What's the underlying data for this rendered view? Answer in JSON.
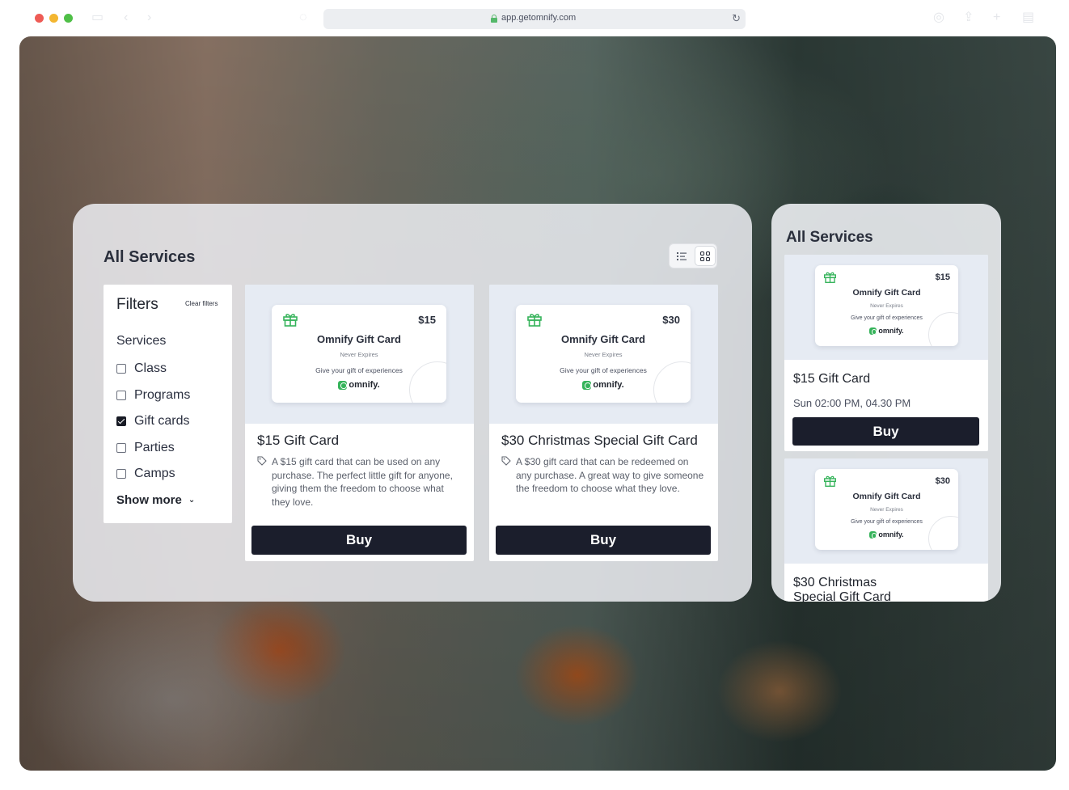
{
  "browser": {
    "url": "app.getomnify.com"
  },
  "main_panel": {
    "title": "All Services",
    "filters": {
      "title": "Filters",
      "clear_label": "Clear filters",
      "section_title": "Services",
      "options": [
        {
          "label": "Class",
          "checked": false
        },
        {
          "label": "Programs",
          "checked": false
        },
        {
          "label": "Gift cards",
          "checked": true
        },
        {
          "label": "Parties",
          "checked": false
        },
        {
          "label": "Camps",
          "checked": false
        }
      ],
      "show_more_label": "Show more"
    },
    "cards": [
      {
        "gift_card": {
          "price": "$15",
          "name": "Omnify Gift Card",
          "expiry": "Never Expires",
          "tagline": "Give your gift of experiences",
          "brand": "omnify."
        },
        "title": "$15 Gift Card",
        "description": "A $15 gift card that can be used on any purchase. The perfect little gift for anyone, giving them the freedom to choose what they love.",
        "buy_label": "Buy"
      },
      {
        "gift_card": {
          "price": "$30",
          "name": "Omnify Gift Card",
          "expiry": "Never Expires",
          "tagline": "Give your gift of experiences",
          "brand": "omnify."
        },
        "title": "$30 Christmas Special Gift Card",
        "description": "A $30 gift card that can be redeemed on any purchase. A great way to give someone the freedom to choose what they love.",
        "buy_label": "Buy"
      }
    ]
  },
  "mobile_panel": {
    "title": "All Services",
    "cards": [
      {
        "gift_card": {
          "price": "$15",
          "name": "Omnify Gift Card",
          "expiry": "Never Expires",
          "tagline": "Give your gift of experiences",
          "brand": "omnify."
        },
        "title": "$15 Gift Card",
        "time": "Sun 02:00 PM, 04.30 PM",
        "buy_label": "Buy"
      },
      {
        "gift_card": {
          "price": "$30",
          "name": "Omnify Gift Card",
          "expiry": "Never Expires",
          "tagline": "Give your gift of experiences",
          "brand": "omnify."
        },
        "title": "$30 Christmas Special Gift Card"
      }
    ]
  },
  "colors": {
    "accent_dark": "#1b1e2c",
    "brand_green": "#35b35a",
    "card_media_bg": "#e6ebf3"
  }
}
